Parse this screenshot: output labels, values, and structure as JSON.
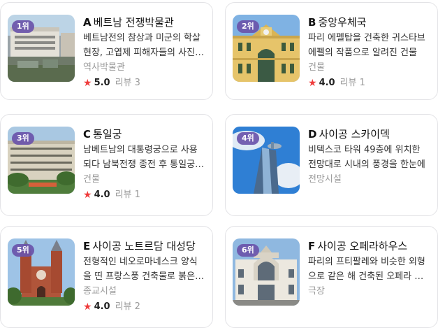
{
  "cards": [
    {
      "rank": "1위",
      "letter": "A",
      "name": "베트남 전쟁박물관",
      "desc": "베트남전의 참상과 미군의 학살현장, 고엽제 피해자들의 사진과 유물을 전시",
      "category": "역사박물관",
      "score": "5.0",
      "reviews": "리뷰 3",
      "image": "museum-building"
    },
    {
      "rank": "2위",
      "letter": "B",
      "name": "중앙우체국",
      "desc": "파리 에펠탑을 건축한 귀스타브 에펠의 작품으로 알려진 건물",
      "category": "건물",
      "score": "4.0",
      "reviews": "리뷰 1",
      "image": "yellow-post-office"
    },
    {
      "rank": "3위",
      "letter": "C",
      "name": "통일궁",
      "desc": "남베트남의 대통령궁으로 사용되다 남북전쟁 종전 후 통일궁으로 개명",
      "category": "건물",
      "score": "4.0",
      "reviews": "리뷰 1",
      "image": "palace"
    },
    {
      "rank": "4위",
      "letter": "D",
      "name": "사이공 스카이덱",
      "desc": "비텍스코 타워 49층에 위치한 전망대로 시내의 풍경을 한눈에",
      "category": "전망시설",
      "score": "",
      "reviews": "",
      "image": "bitexco-tower"
    },
    {
      "rank": "5위",
      "letter": "E",
      "name": "사이공 노트르담 대성당",
      "desc": "전형적인 네오로마네스크 양식을 띤 프랑스풍 건축물로 붉은 벽돌 외관",
      "category": "종교시설",
      "score": "4.0",
      "reviews": "리뷰 2",
      "image": "cathedral"
    },
    {
      "rank": "6위",
      "letter": "F",
      "name": "사이공 오페라하우스",
      "desc": "파리의 프티팔레와 비슷한 외형으로 같은 해 건축된 오페라 하우스",
      "category": "극장",
      "score": "",
      "reviews": "",
      "image": "opera-house"
    }
  ],
  "colors": {
    "rank_badge": "#6a54aa",
    "star": "#ef3b3b",
    "muted": "#9a9a9a"
  }
}
